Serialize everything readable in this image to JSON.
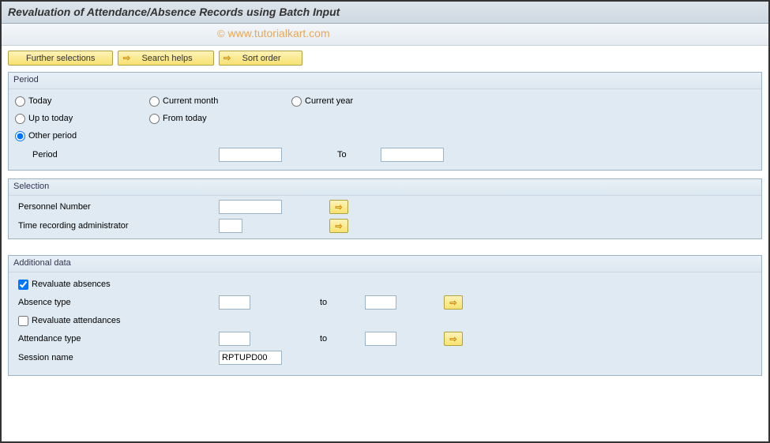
{
  "header": {
    "title": "Revaluation of Attendance/Absence Records using Batch Input"
  },
  "watermark": {
    "copy": "©",
    "text": "www.tutorialkart.com"
  },
  "toolbar": {
    "further_selections": "Further selections",
    "search_helps": "Search helps",
    "sort_order": "Sort order"
  },
  "period_group": {
    "title": "Period",
    "options": {
      "today": "Today",
      "current_month": "Current month",
      "current_year": "Current year",
      "up_to_today": "Up to today",
      "from_today": "From today",
      "other_period": "Other period"
    },
    "selected": "other_period",
    "period_label": "Period",
    "to_label": "To",
    "period_from": "",
    "period_to": ""
  },
  "selection_group": {
    "title": "Selection",
    "personnel_number_label": "Personnel Number",
    "personnel_number_value": "",
    "time_admin_label": "Time recording administrator",
    "time_admin_value": ""
  },
  "additional_group": {
    "title": "Additional data",
    "revaluate_absences_label": "Revaluate absences",
    "revaluate_absences_checked": true,
    "absence_type_label": "Absence type",
    "absence_type_from": "",
    "absence_type_to": "",
    "revaluate_attendances_label": "Revaluate attendances",
    "revaluate_attendances_checked": false,
    "attendance_type_label": "Attendance type",
    "attendance_type_from": "",
    "attendance_type_to": "",
    "to_label": "to",
    "session_name_label": "Session name",
    "session_name_value": "RPTUPD00"
  }
}
